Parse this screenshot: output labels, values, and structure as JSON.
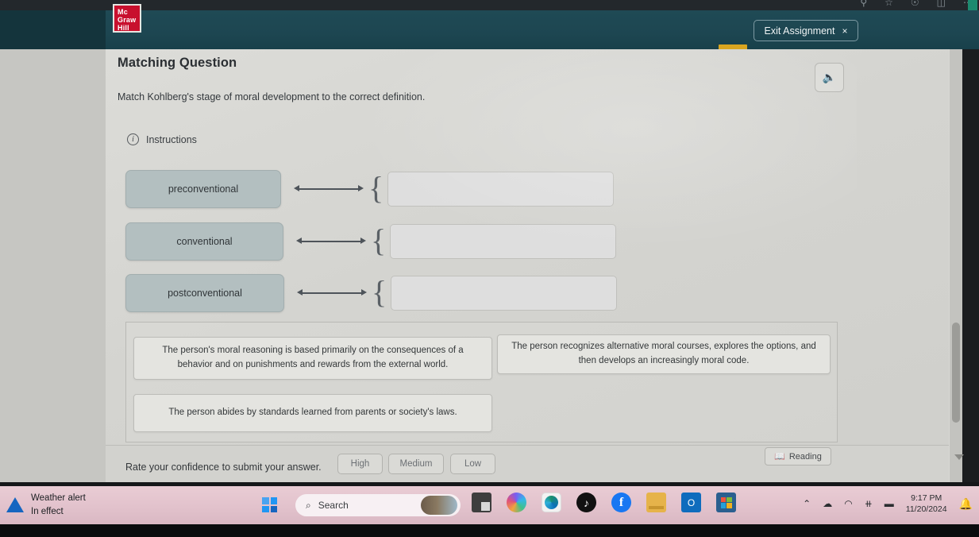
{
  "browser": {
    "toolbar_icons": [
      "search-icon",
      "bookmark-icon",
      "collections-icon",
      "split-screen-icon",
      "more-icon"
    ]
  },
  "header": {
    "logo_line1": "Mc",
    "logo_line2": "Graw",
    "logo_line3": "Hill",
    "exit_label": "Exit Assignment",
    "exit_close_glyph": "×",
    "accent_color": "#1f4a55",
    "logo_color": "#c8102e",
    "tab_marker_color": "#d9a520"
  },
  "question": {
    "title": "Matching Question",
    "prompt": "Match Kohlberg's stage of moral development to the correct definition.",
    "instructions_label": "Instructions",
    "info_glyph": "i",
    "audio_glyph": "◁))"
  },
  "matching": {
    "brace_glyph": "{",
    "rows": [
      {
        "term": "preconventional",
        "answer": ""
      },
      {
        "term": "conventional",
        "answer": ""
      },
      {
        "term": "postconventional",
        "answer": ""
      }
    ]
  },
  "answer_options": [
    "The person's moral reasoning is based primarily on the consequences of a behavior and on punishments and rewards from the external world.",
    "The person recognizes alternative moral courses, explores the options, and then develops an increasingly moral code.",
    "The person abides by standards learned from parents or society's laws."
  ],
  "footer": {
    "confidence_label": "Rate your confidence to submit your answer.",
    "confidence_buttons": [
      "High",
      "Medium",
      "Low"
    ],
    "reading_label": "Reading",
    "book_glyph": "📖"
  },
  "taskbar": {
    "weather_title": "Weather alert",
    "weather_subtitle": "In effect",
    "search_placeholder": "Search",
    "search_glyph": "⌕",
    "apps": [
      {
        "name": "task-view",
        "glyph": ""
      },
      {
        "name": "copilot",
        "glyph": ""
      },
      {
        "name": "edge",
        "glyph": ""
      },
      {
        "name": "tiktok",
        "glyph": "♪"
      },
      {
        "name": "facebook",
        "glyph": "f"
      },
      {
        "name": "file-explorer",
        "glyph": ""
      },
      {
        "name": "outlook",
        "glyph": "O"
      },
      {
        "name": "microsoft-store",
        "glyph": ""
      }
    ],
    "tray": {
      "chevron_glyph": "⌃",
      "cloud_glyph": "☁",
      "wifi_glyph": "◠",
      "volume_glyph": "⧺",
      "battery_glyph": "▬",
      "time": "9:17 PM",
      "date": "11/20/2024",
      "bell_glyph": "🔔"
    }
  }
}
